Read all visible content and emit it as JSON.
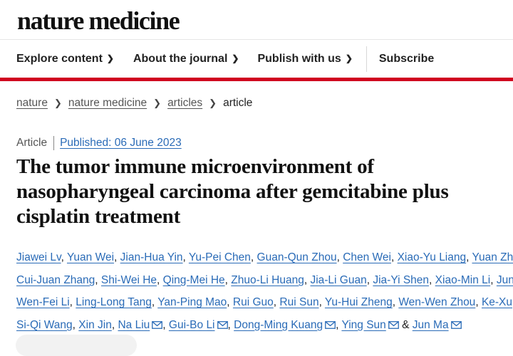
{
  "masthead": "nature medicine",
  "nav": {
    "items": [
      {
        "label": "Explore content"
      },
      {
        "label": "About the journal"
      },
      {
        "label": "Publish with us"
      }
    ],
    "subscribe": "Subscribe"
  },
  "breadcrumb": {
    "items": [
      "nature",
      "nature medicine",
      "articles"
    ],
    "current": "article"
  },
  "article": {
    "type": "Article",
    "published": "Published: 06 June 2023",
    "title": "The tumor immune microenvironment of nasopharyngeal carcinoma after gemcitabine plus cisplatin treatment"
  },
  "authors": {
    "line1": [
      "Jiawei Lv",
      "Yuan Wei",
      "Jian-Hua Yin",
      "Yu-Pei Chen",
      "Guan-Qun Zhou",
      "Chen Wei",
      "Xiao-Yu Liang",
      "Yuan Zhan"
    ],
    "line2": [
      "Cui-Juan Zhang",
      "Shi-Wei He",
      "Qing-Mei He",
      "Zhuo-Li Huang",
      "Jia-Li Guan",
      "Jia-Yi Shen",
      "Xiao-Min Li",
      "Jun-"
    ],
    "line3": [
      "Wen-Fei Li",
      "Ling-Long Tang",
      "Yan-Ping Mao",
      "Rui Guo",
      "Rui Sun",
      "Yu-Hui Zheng",
      "Wen-Wen Zhou",
      "Ke-Xu"
    ],
    "line4": [
      "Si-Qi Wang",
      "Xin Jin",
      "Na Liu",
      "Gui-Bo Li",
      "Dong-Ming Kuang",
      "Ying Sun",
      "Jun Ma"
    ],
    "ampersand": "&"
  },
  "icons": {
    "dropdown": "chevron-down-icon",
    "email": "envelope-icon"
  },
  "colors": {
    "accent_red": "#d0001f",
    "link_blue": "#2a6bb7"
  }
}
